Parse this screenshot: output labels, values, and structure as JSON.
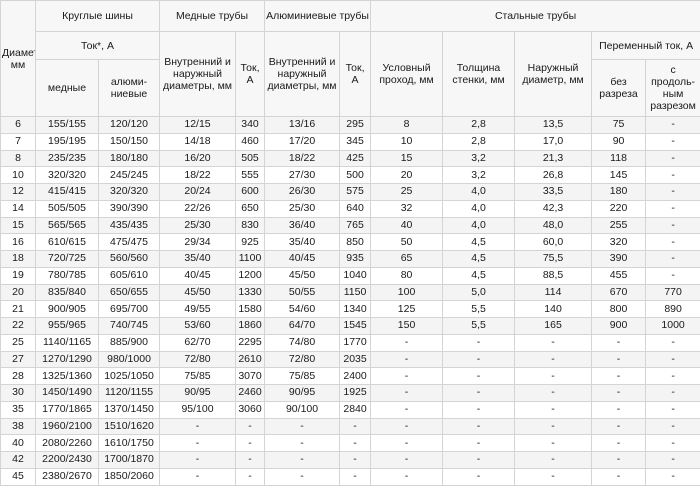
{
  "header": {
    "diameter": "Диаметр, мм",
    "round_bus": "Круглые шины",
    "copper_pipes": "Медные трубы",
    "aluminum_pipes": "Алюминиевые трубы",
    "steel_pipes": "Стальные трубы",
    "current_round": "Ток*, А",
    "copper": "медные",
    "aluminum": "алюми-ниевые",
    "inner_outer_cu": "Внутренний и наружный диаметры, мм",
    "current_cu": "Ток, А",
    "inner_outer_al": "Внутренний и наружный диаметры, мм",
    "current_al": "Ток, А",
    "nominal_bore": "Условный проход, мм",
    "wall_thickness": "Толщина стенки, мм",
    "outer_diameter": "Наружный диаметр, мм",
    "ac_current": "Переменный ток, А",
    "no_slot": "без разреза",
    "with_slot": "с продоль-ным разрезом"
  },
  "rows": [
    [
      "6",
      "155/155",
      "120/120",
      "12/15",
      "340",
      "13/16",
      "295",
      "8",
      "2,8",
      "13,5",
      "75",
      "-"
    ],
    [
      "7",
      "195/195",
      "150/150",
      "14/18",
      "460",
      "17/20",
      "345",
      "10",
      "2,8",
      "17,0",
      "90",
      "-"
    ],
    [
      "8",
      "235/235",
      "180/180",
      "16/20",
      "505",
      "18/22",
      "425",
      "15",
      "3,2",
      "21,3",
      "118",
      "-"
    ],
    [
      "10",
      "320/320",
      "245/245",
      "18/22",
      "555",
      "27/30",
      "500",
      "20",
      "3,2",
      "26,8",
      "145",
      "-"
    ],
    [
      "12",
      "415/415",
      "320/320",
      "20/24",
      "600",
      "26/30",
      "575",
      "25",
      "4,0",
      "33,5",
      "180",
      "-"
    ],
    [
      "14",
      "505/505",
      "390/390",
      "22/26",
      "650",
      "25/30",
      "640",
      "32",
      "4,0",
      "42,3",
      "220",
      "-"
    ],
    [
      "15",
      "565/565",
      "435/435",
      "25/30",
      "830",
      "36/40",
      "765",
      "40",
      "4,0",
      "48,0",
      "255",
      "-"
    ],
    [
      "16",
      "610/615",
      "475/475",
      "29/34",
      "925",
      "35/40",
      "850",
      "50",
      "4,5",
      "60,0",
      "320",
      "-"
    ],
    [
      "18",
      "720/725",
      "560/560",
      "35/40",
      "1100",
      "40/45",
      "935",
      "65",
      "4,5",
      "75,5",
      "390",
      "-"
    ],
    [
      "19",
      "780/785",
      "605/610",
      "40/45",
      "1200",
      "45/50",
      "1040",
      "80",
      "4,5",
      "88,5",
      "455",
      "-"
    ],
    [
      "20",
      "835/840",
      "650/655",
      "45/50",
      "1330",
      "50/55",
      "1150",
      "100",
      "5,0",
      "114",
      "670",
      "770"
    ],
    [
      "21",
      "900/905",
      "695/700",
      "49/55",
      "1580",
      "54/60",
      "1340",
      "125",
      "5,5",
      "140",
      "800",
      "890"
    ],
    [
      "22",
      "955/965",
      "740/745",
      "53/60",
      "1860",
      "64/70",
      "1545",
      "150",
      "5,5",
      "165",
      "900",
      "1000"
    ],
    [
      "25",
      "1140/1165",
      "885/900",
      "62/70",
      "2295",
      "74/80",
      "1770",
      "-",
      "-",
      "-",
      "-",
      "-"
    ],
    [
      "27",
      "1270/1290",
      "980/1000",
      "72/80",
      "2610",
      "72/80",
      "2035",
      "-",
      "-",
      "-",
      "-",
      "-"
    ],
    [
      "28",
      "1325/1360",
      "1025/1050",
      "75/85",
      "3070",
      "75/85",
      "2400",
      "-",
      "-",
      "-",
      "-",
      "-"
    ],
    [
      "30",
      "1450/1490",
      "1120/1155",
      "90/95",
      "2460",
      "90/95",
      "1925",
      "-",
      "-",
      "-",
      "-",
      "-"
    ],
    [
      "35",
      "1770/1865",
      "1370/1450",
      "95/100",
      "3060",
      "90/100",
      "2840",
      "-",
      "-",
      "-",
      "-",
      "-"
    ],
    [
      "38",
      "1960/2100",
      "1510/1620",
      "-",
      "-",
      "-",
      "-",
      "-",
      "-",
      "-",
      "-",
      "-"
    ],
    [
      "40",
      "2080/2260",
      "1610/1750",
      "-",
      "-",
      "-",
      "-",
      "-",
      "-",
      "-",
      "-",
      "-"
    ],
    [
      "42",
      "2200/2430",
      "1700/1870",
      "-",
      "-",
      "-",
      "-",
      "-",
      "-",
      "-",
      "-",
      "-"
    ],
    [
      "45",
      "2380/2670",
      "1850/2060",
      "-",
      "-",
      "-",
      "-",
      "-",
      "-",
      "-",
      "-",
      "-"
    ]
  ]
}
